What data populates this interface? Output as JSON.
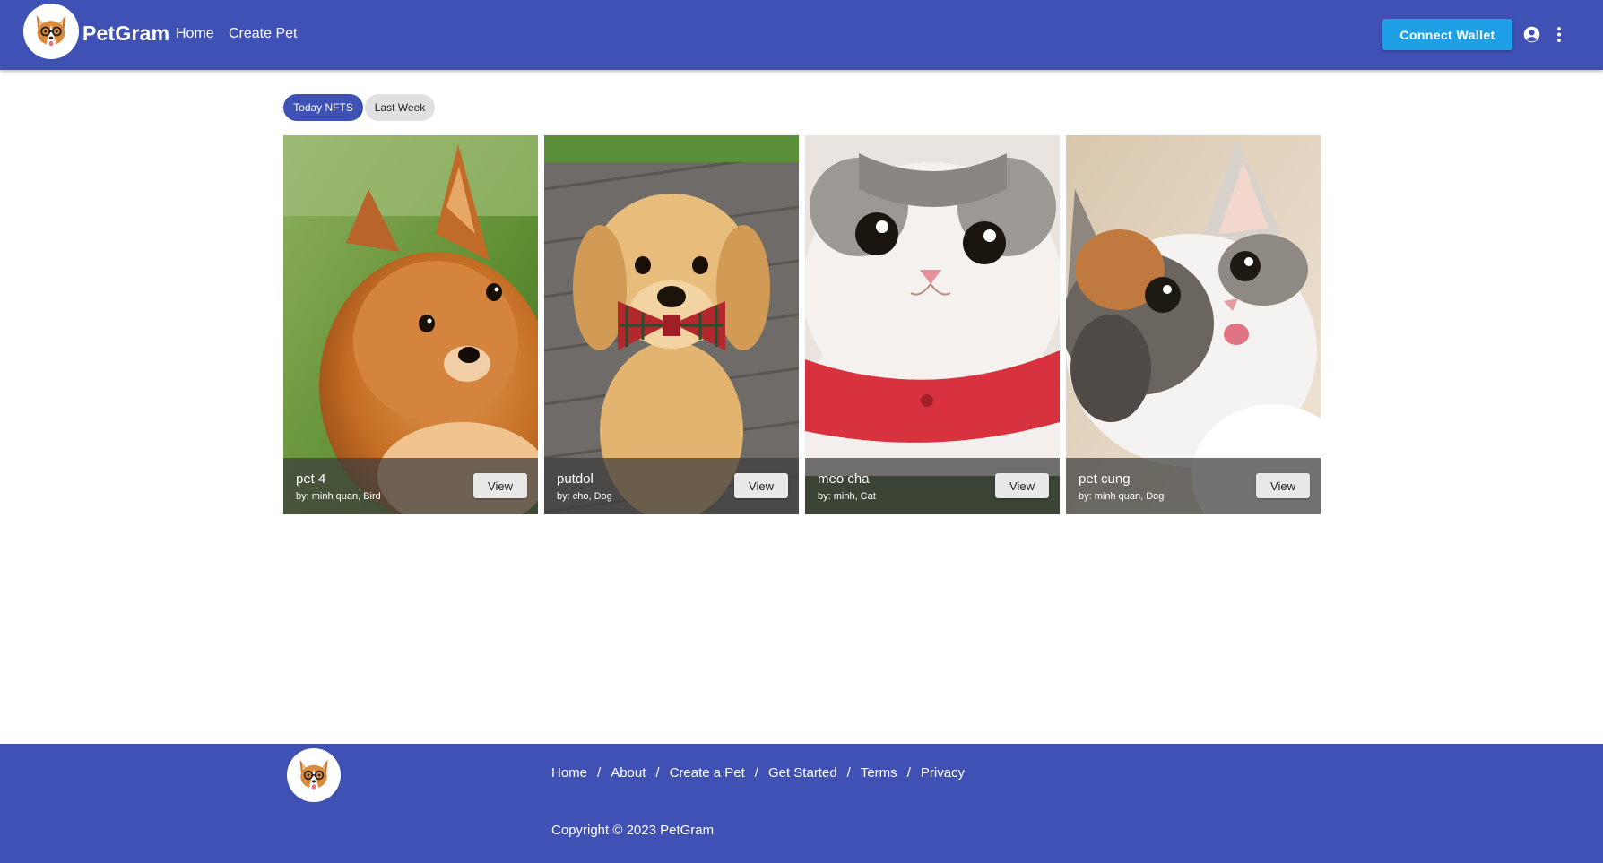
{
  "header": {
    "brand": "PetGram",
    "nav": [
      {
        "label": "Home"
      },
      {
        "label": "Create Pet"
      }
    ],
    "connect_wallet_label": "Connect Wallet",
    "icons": {
      "account": "account-circle-icon",
      "more": "more-vert-icon"
    },
    "colors": {
      "bar": "#3f51b5",
      "wallet_button": "#1e9fe6"
    }
  },
  "tabs": [
    {
      "label": "Today NFTS",
      "active": true
    },
    {
      "label": "Last Week",
      "active": false
    }
  ],
  "cards": [
    {
      "name": "pet 4",
      "meta": "by: minh quan, Bird",
      "image": "pomeranian-photo",
      "action": "View"
    },
    {
      "name": "putdol",
      "meta": "by: cho, Dog",
      "image": "golden-puppy-bowtie-photo",
      "action": "View"
    },
    {
      "name": "meo cha",
      "meta": "by: minh, Cat",
      "image": "white-cat-red-vest-photo",
      "action": "View"
    },
    {
      "name": "pet cung",
      "meta": "by: minh quan, Dog",
      "image": "calico-cat-tongue-photo",
      "action": "View"
    }
  ],
  "footer": {
    "links": [
      {
        "label": "Home"
      },
      {
        "label": "About"
      },
      {
        "label": "Create a Pet"
      },
      {
        "label": "Get Started"
      },
      {
        "label": "Terms"
      },
      {
        "label": "Privacy"
      }
    ],
    "separator": "/",
    "copyright": "Copyright © 2023 PetGram"
  }
}
